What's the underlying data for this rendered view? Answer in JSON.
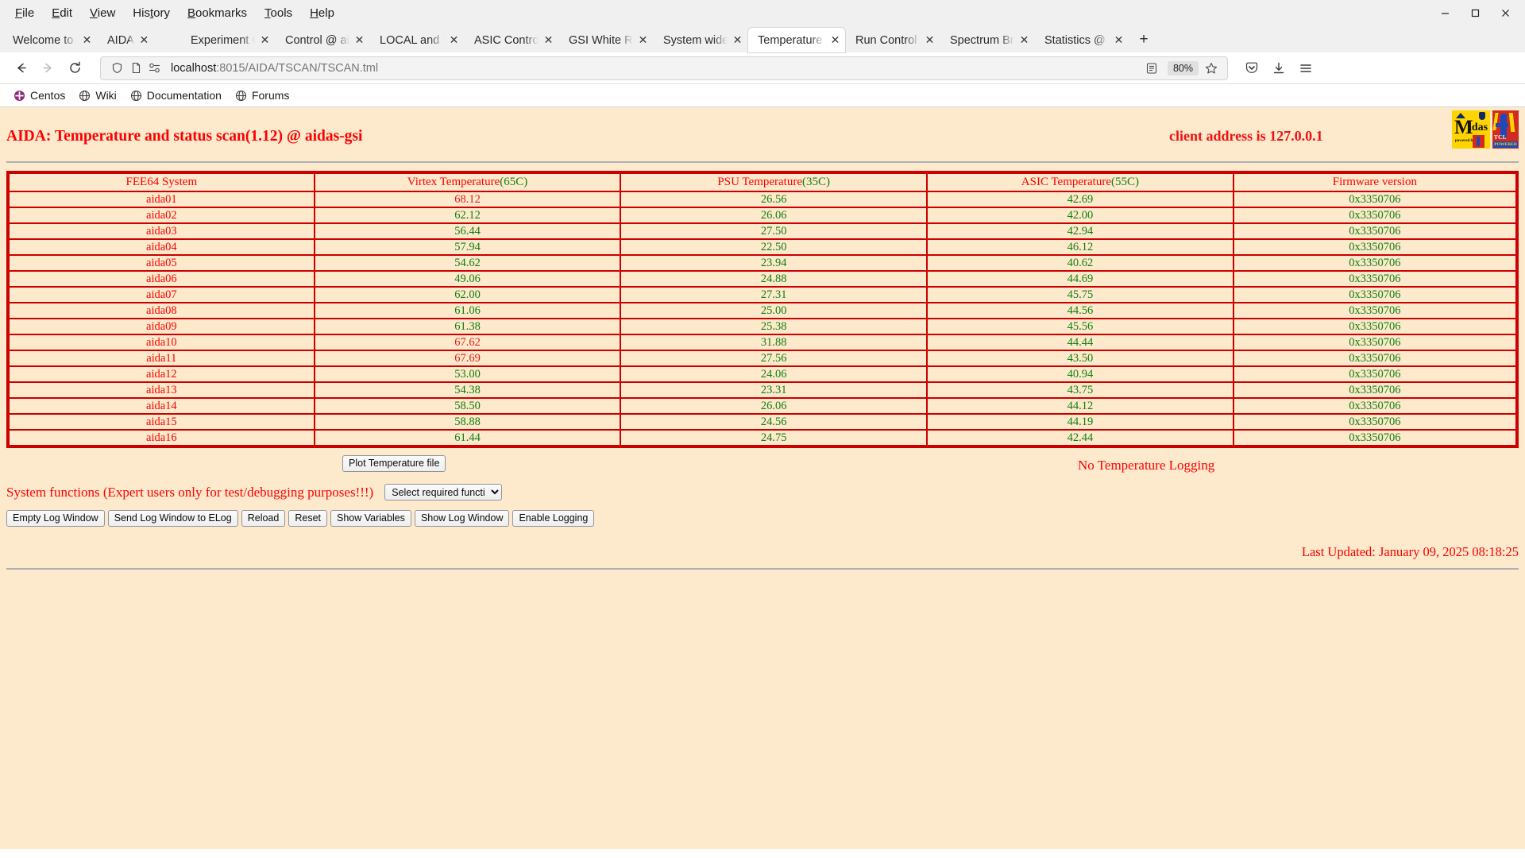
{
  "browser": {
    "menus": [
      "File",
      "Edit",
      "View",
      "History",
      "Bookmarks",
      "Tools",
      "Help"
    ],
    "window_controls": {
      "minimize": "—",
      "maximize": "☐",
      "close": "✕"
    },
    "tabs": [
      {
        "label": "Welcome to CentO",
        "active": false
      },
      {
        "label": "AIDA",
        "active": false
      },
      {
        "label": "Experiment Contro",
        "active": false
      },
      {
        "label": "Control @ aidas-gs",
        "active": false
      },
      {
        "label": "LOCAL and Wavefo",
        "active": false
      },
      {
        "label": "ASIC Control @ aid",
        "active": false
      },
      {
        "label": "GSI White Rabbit T",
        "active": false
      },
      {
        "label": "System wide Chec",
        "active": false
      },
      {
        "label": "Temperature and s",
        "active": true
      },
      {
        "label": "Run Control @ aida",
        "active": false
      },
      {
        "label": "Spectrum Browser",
        "active": false
      },
      {
        "label": "Statistics @ aidas-",
        "active": false
      }
    ],
    "new_tab_label": "+",
    "nav": {
      "back": "←",
      "forward": "→",
      "reload": "↻"
    },
    "url": {
      "host": "localhost",
      "rest": ":8015/AIDA/TSCAN/TSCAN.tml"
    },
    "zoom": "80%",
    "bookmarks": [
      {
        "label": "Centos",
        "icon": "centos-icon"
      },
      {
        "label": "Wiki",
        "icon": "globe-icon"
      },
      {
        "label": "Documentation",
        "icon": "globe-icon"
      },
      {
        "label": "Forums",
        "icon": "globe-icon"
      }
    ]
  },
  "page": {
    "title": "AIDA: Temperature and status scan(1.12) @ aidas-gsi",
    "client_address": "client address is 127.0.0.1",
    "logos": {
      "midas": {
        "m": "M",
        "idas": "idas",
        "powered": "powered by",
        "alt": "midas-logo"
      },
      "tcl": {
        "tcl": "TCL",
        "powered": "POWERED",
        "alt": "tcl-logo"
      }
    },
    "table": {
      "columns": [
        {
          "label": "FEE64 System",
          "unit": ""
        },
        {
          "label": "Virtex Temperature",
          "unit": "(65C)"
        },
        {
          "label": "PSU Temperature",
          "unit": "(35C)"
        },
        {
          "label": "ASIC Temperature",
          "unit": "(55C)"
        },
        {
          "label": "Firmware version",
          "unit": ""
        }
      ],
      "rows": [
        {
          "system": "aida01",
          "virtex": "68.12",
          "virtex_state": "hot",
          "psu": "26.56",
          "asic": "42.69",
          "firmware": "0x3350706"
        },
        {
          "system": "aida02",
          "virtex": "62.12",
          "virtex_state": "ok",
          "psu": "26.06",
          "asic": "42.00",
          "firmware": "0x3350706"
        },
        {
          "system": "aida03",
          "virtex": "56.44",
          "virtex_state": "ok",
          "psu": "27.50",
          "asic": "42.94",
          "firmware": "0x3350706"
        },
        {
          "system": "aida04",
          "virtex": "57.94",
          "virtex_state": "ok",
          "psu": "22.50",
          "asic": "46.12",
          "firmware": "0x3350706"
        },
        {
          "system": "aida05",
          "virtex": "54.62",
          "virtex_state": "ok",
          "psu": "23.94",
          "asic": "40.62",
          "firmware": "0x3350706"
        },
        {
          "system": "aida06",
          "virtex": "49.06",
          "virtex_state": "ok",
          "psu": "24.88",
          "asic": "44.69",
          "firmware": "0x3350706"
        },
        {
          "system": "aida07",
          "virtex": "62.00",
          "virtex_state": "ok",
          "psu": "27.31",
          "asic": "45.75",
          "firmware": "0x3350706"
        },
        {
          "system": "aida08",
          "virtex": "61.06",
          "virtex_state": "ok",
          "psu": "25.00",
          "asic": "44.56",
          "firmware": "0x3350706"
        },
        {
          "system": "aida09",
          "virtex": "61.38",
          "virtex_state": "ok",
          "psu": "25.38",
          "asic": "45.56",
          "firmware": "0x3350706"
        },
        {
          "system": "aida10",
          "virtex": "67.62",
          "virtex_state": "hot",
          "psu": "31.88",
          "asic": "44.44",
          "firmware": "0x3350706"
        },
        {
          "system": "aida11",
          "virtex": "67.69",
          "virtex_state": "hot",
          "psu": "27.56",
          "asic": "43.50",
          "firmware": "0x3350706"
        },
        {
          "system": "aida12",
          "virtex": "53.00",
          "virtex_state": "ok",
          "psu": "24.06",
          "asic": "40.94",
          "firmware": "0x3350706"
        },
        {
          "system": "aida13",
          "virtex": "54.38",
          "virtex_state": "ok",
          "psu": "23.31",
          "asic": "43.75",
          "firmware": "0x3350706"
        },
        {
          "system": "aida14",
          "virtex": "58.50",
          "virtex_state": "ok",
          "psu": "26.06",
          "asic": "44.12",
          "firmware": "0x3350706"
        },
        {
          "system": "aida15",
          "virtex": "58.88",
          "virtex_state": "ok",
          "psu": "24.56",
          "asic": "44.19",
          "firmware": "0x3350706"
        },
        {
          "system": "aida16",
          "virtex": "61.44",
          "virtex_state": "ok",
          "psu": "24.75",
          "asic": "42.44",
          "firmware": "0x3350706"
        }
      ]
    },
    "controls": {
      "plot_button": "Plot Temperature file",
      "logging_status": "No Temperature Logging",
      "system_functions_label": "System functions (Expert users only for test/debugging purposes!!!)",
      "system_functions_selected": "Select required function",
      "system_functions_options": [
        "Select required function"
      ],
      "buttons": [
        "Empty Log Window",
        "Send Log Window to ELog",
        "Reload",
        "Reset",
        "Show Variables",
        "Show Log Window",
        "Enable Logging"
      ]
    },
    "last_updated": "Last Updated: January 09, 2025 08:18:25"
  },
  "colors": {
    "page_bg": "#fde9cc",
    "accent_red": "#fc0000",
    "border_red": "#cc0000",
    "value_green": "#108010",
    "value_hot": "#e01b1b"
  }
}
